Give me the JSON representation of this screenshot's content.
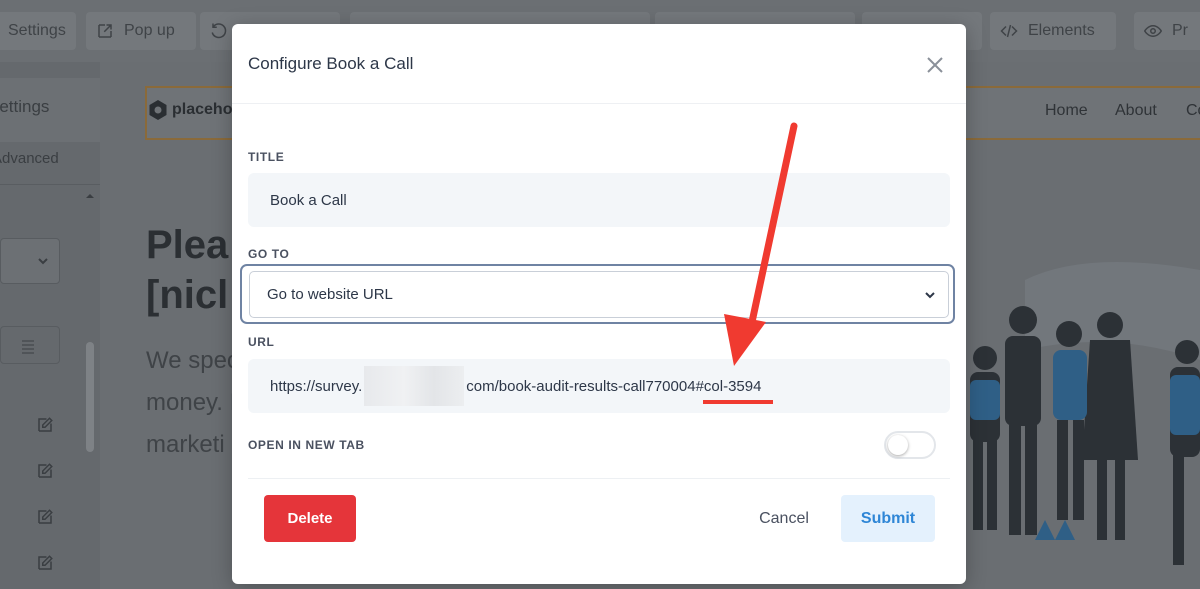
{
  "topbar": {
    "settings_label": "Settings",
    "popup_label": "Pop up",
    "elements_label": "Elements",
    "preview_label": "Pr"
  },
  "sidebar": {
    "settings_label": "Settings",
    "advanced_label": "Advanced"
  },
  "site": {
    "logo_text": "placehol",
    "nav": [
      "Home",
      "About",
      "Co"
    ],
    "hero_heading_lines": [
      "Plea",
      "[nicl"
    ],
    "hero_paragraph_lines": [
      "We spec",
      "money. I",
      "marketi"
    ]
  },
  "modal": {
    "title": "Configure Book a Call",
    "title_field": {
      "label": "TITLE",
      "value": "Book a Call"
    },
    "goto_field": {
      "label": "GO TO",
      "selected": "Go to website URL"
    },
    "url_field": {
      "label": "URL",
      "prefix": "https://survey.",
      "suffix": "com/book-audit-results-call770004",
      "anchor": "#col-3594"
    },
    "new_tab_field": {
      "label": "OPEN IN NEW TAB",
      "enabled": false
    },
    "delete_label": "Delete",
    "cancel_label": "Cancel",
    "submit_label": "Submit"
  },
  "colors": {
    "delete": "#e5353a",
    "submit_bg": "#e4f1fd",
    "submit_text": "#2e86d6",
    "annotation": "#f03a30"
  }
}
